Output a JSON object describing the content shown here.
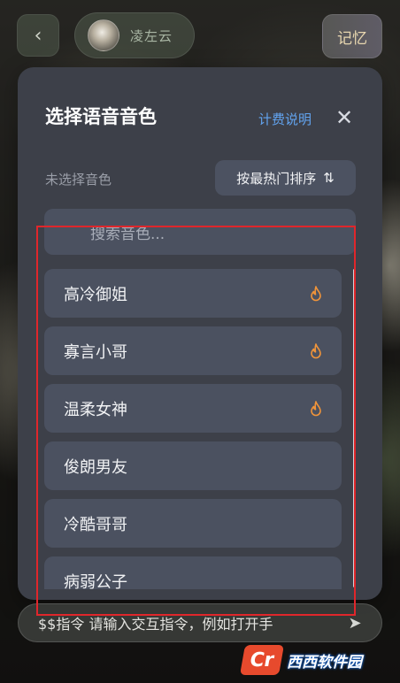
{
  "header": {
    "back_icon": "chevron-left-icon",
    "character_name": "凌左云",
    "memory_label": "记忆"
  },
  "modal": {
    "title": "选择语音音色",
    "billing_link": "计费说明",
    "close_icon": "close-icon",
    "selection_status": "未选择音色",
    "sort_label": "按最热门排序",
    "sort_icon": "sort-arrows-icon",
    "search_placeholder": "搜索音色...",
    "voices": [
      {
        "name": "高冷御姐",
        "hot": true
      },
      {
        "name": "寡言小哥",
        "hot": true
      },
      {
        "name": "温柔女神",
        "hot": true
      },
      {
        "name": "俊朗男友",
        "hot": false
      },
      {
        "name": "冷酷哥哥",
        "hot": false
      },
      {
        "name": "病弱公子",
        "hot": false
      }
    ]
  },
  "input": {
    "text": "$$指令 请输入交互指令，例如打开手"
  },
  "watermark": {
    "badge": "Cr",
    "text": "西西软件园"
  },
  "colors": {
    "accent_link": "#62a4f0",
    "hot_icon": "#f0943a",
    "highlight": "#e0262b",
    "modal_bg": "#3d4049",
    "item_bg": "#4b5160"
  }
}
